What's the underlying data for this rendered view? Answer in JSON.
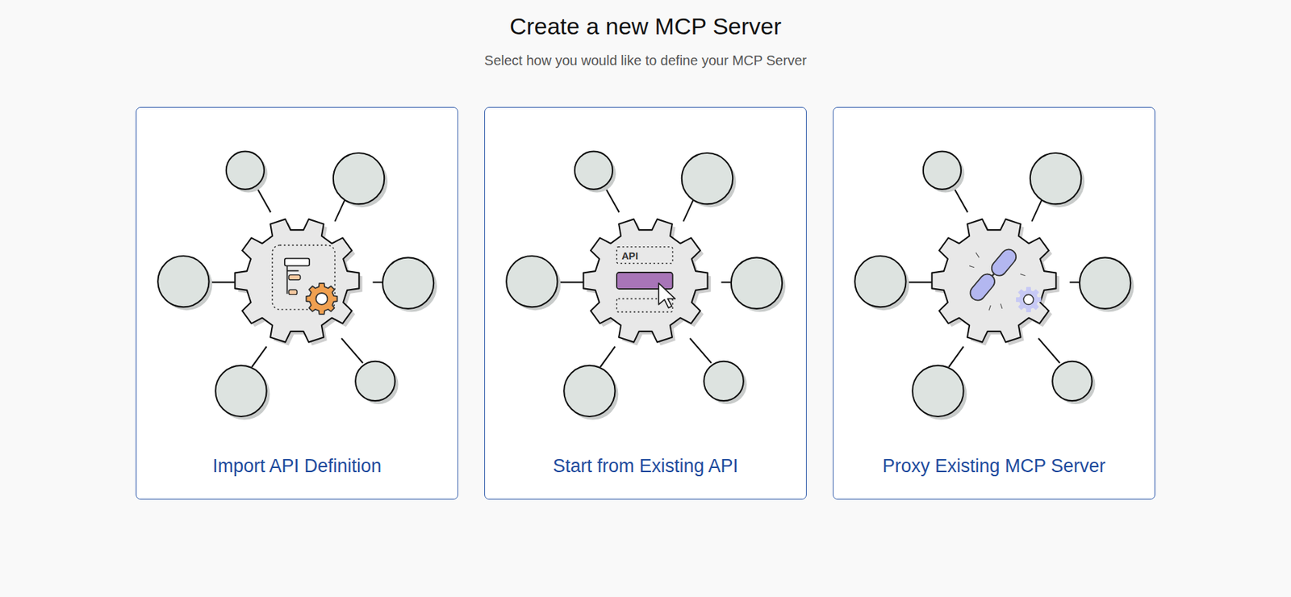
{
  "page": {
    "title": "Create a new MCP Server",
    "subtitle": "Select how you would like to define your MCP Server"
  },
  "options": [
    {
      "label": "Import API Definition",
      "kind": "import"
    },
    {
      "label": "Start from Existing API",
      "kind": "existing",
      "icon_text": "API"
    },
    {
      "label": "Proxy Existing MCP Server",
      "kind": "proxy"
    }
  ]
}
